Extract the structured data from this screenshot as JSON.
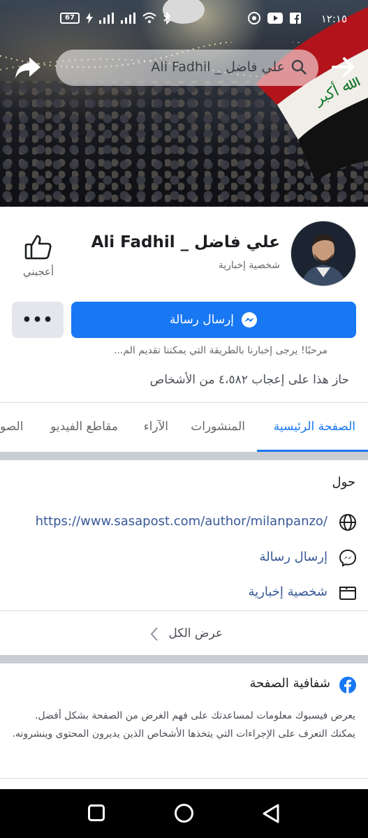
{
  "status_bar": {
    "time": "١٢:١٥",
    "battery": "67"
  },
  "search": {
    "query": "علي فاضل _ Ali Fadhil"
  },
  "profile": {
    "name": "Ali Fadhil _ علي فاضل",
    "category": "شخصية إخبارية",
    "like_label": "أعجبني",
    "send_message_label": "إرسال رسالة",
    "more_label": "•••",
    "greeting": "مرحبًا! يرجى إخبارنا بالطريقة التي يمكننا تقديم الم...",
    "likes_count": "حاز هذا على إعجاب ٤،٥٨٢ من الأشخاص"
  },
  "tabs": [
    {
      "label": "الصفحة الرئيسية",
      "active": true
    },
    {
      "label": "المنشورات",
      "active": false
    },
    {
      "label": "الآراء",
      "active": false
    },
    {
      "label": "مقاطع الفيديو",
      "active": false
    },
    {
      "label": "الصو",
      "active": false
    }
  ],
  "about": {
    "title": "حول",
    "website": "https://www.sasapost.com/author/milanpanzo/",
    "message": "إرسال رسالة",
    "category": "شخصية إخبارية",
    "see_all": "عرض الكل"
  },
  "transparency": {
    "title": "شفافية الصفحة",
    "body": "يعرض فيسبوك معلومات لمساعدتك على فهم الغرض من الصفحة بشكل أفضل. يمكنك التعرف على الإجراءات التي يتخذها الأشخاص الذين يديرون المحتوى وينشرونه."
  },
  "colors": {
    "accent": "#1877f2",
    "link": "#385898",
    "secondary_button": "#e4e6eb"
  }
}
